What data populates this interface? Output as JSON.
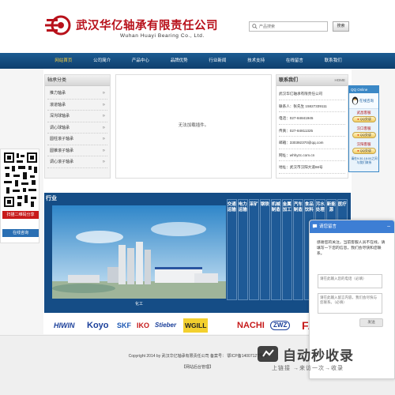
{
  "header": {
    "company_cn": "武汉华亿轴承有限责任公司",
    "company_en": "Wuhan Huayi Bearing Co., Ltd.",
    "search_placeholder": "产品搜索",
    "search_button": "搜索"
  },
  "nav": {
    "items": [
      "网站首页",
      "公司简介",
      "产品中心",
      "品牌优势",
      "行业新闻",
      "技术支持",
      "在线留言",
      "联系我们"
    ],
    "active_index": 0
  },
  "categories": {
    "title": "轴承分类",
    "items": [
      "推力轴承",
      "滚道轴承",
      "深沟球轴承",
      "调心球轴承",
      "圆柱滚子轴承",
      "圆锥滚子轴承",
      "调心滚子轴承"
    ]
  },
  "notice": {
    "text": "无法加载插件。"
  },
  "contact": {
    "title": "联系我们",
    "home": "HOME",
    "lines": [
      "武汉华亿轴承有限责任公司",
      "联系人：张先生 15827339111",
      "电话：027-84841945",
      "传真：027-84811325",
      "邮箱：330392370@qq.com",
      "网址：whhyzc.com.cn",
      "地址：武汉市汉阳大道66号"
    ]
  },
  "qq": {
    "header": "QQ Online",
    "title": "在线咨询",
    "groups": [
      {
        "label": "武昌客服",
        "button": "QQ交谈"
      },
      {
        "label": "汉口客服",
        "button": "QQ交谈"
      },
      {
        "label": "汉阳客服",
        "button": "QQ交谈"
      }
    ],
    "footer": "请在9:30-18:00之间与我们联系"
  },
  "products": {
    "title": "行业",
    "caption": "化工",
    "tags": [
      "交通运输",
      "电力运输",
      "采矿",
      "钢铁",
      "机械制造",
      "金属加工",
      "汽车制造",
      "食品饮料",
      "污水处理",
      "新能源",
      "医疗",
      "航天",
      "造纸"
    ]
  },
  "brands": [
    "HIWIN",
    "Koyo",
    "SKF",
    "IKO",
    "Stieber",
    "WGILL",
    "NACHI",
    "ZWZ",
    "FAG"
  ],
  "footer": {
    "copyright": "Copyright 2014 by 武汉华亿轴承有限责任公司 备案号： 鄂ICP备14007127号-1",
    "admin_link": "【网站后台管理】"
  },
  "qr": {
    "red_label": "扫描二维码分享",
    "button": "在线咨询"
  },
  "message": {
    "title": "请您留言",
    "minimize": "–",
    "body": "感谢您的关注，当前客服人员不在线，请填写一下您的信息，我们会尽快和您联系。",
    "phone_placeholder": "请在此输入您的电话（必填）",
    "message_placeholder": "请在此输入留言内容，我们会尽快与您联系。（必填）",
    "send": "发送"
  },
  "watermark": {
    "title": "自动秒收录",
    "sub": "上链接 →来访一次→收录"
  },
  "colors": {
    "brand_red": "#b8111b",
    "nav_blue": "#1c5c92",
    "product_blue": "#154d86",
    "active_nav": "#ffd23c"
  }
}
